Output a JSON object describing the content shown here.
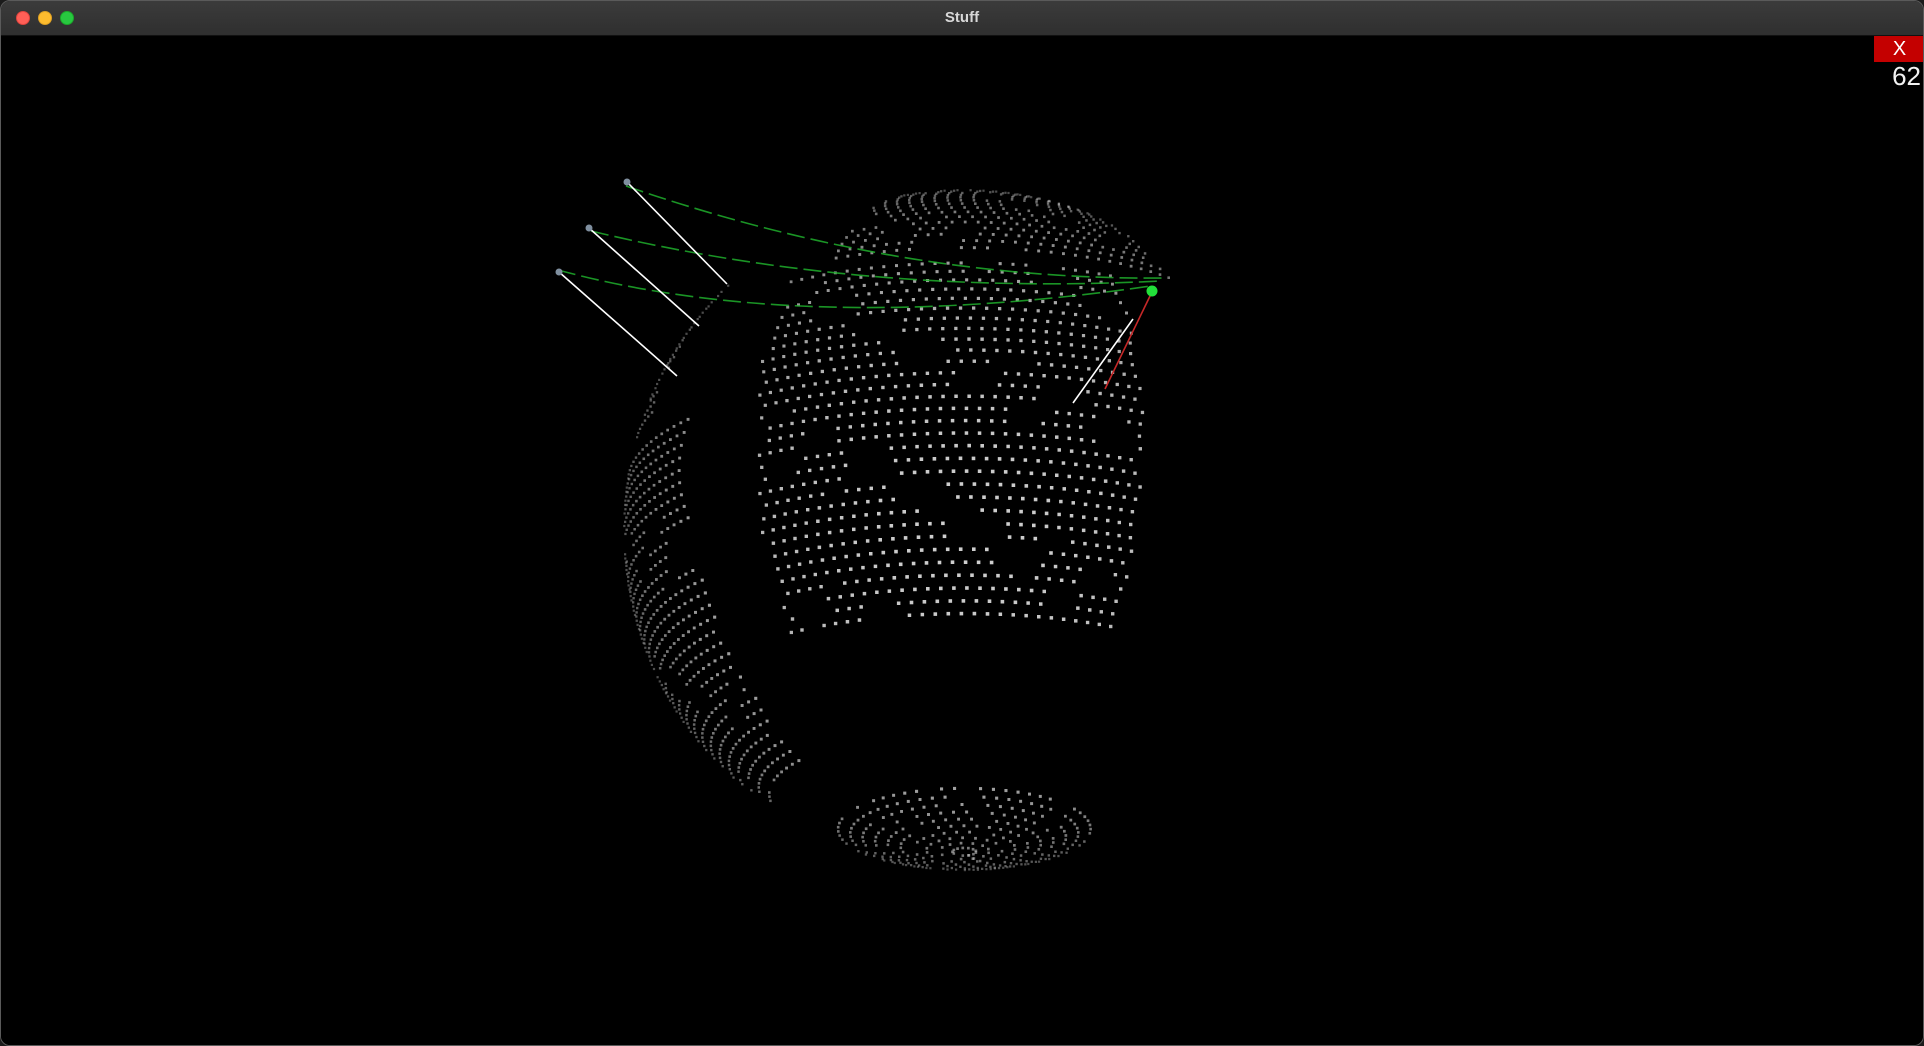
{
  "window": {
    "title": "Stuff"
  },
  "hud": {
    "close_label": "X",
    "fps": "62"
  },
  "colors": {
    "background": "#000000",
    "land_dots": "#d9d9d9",
    "orbit_trail": "#1fae2b",
    "satellite_marker": "#22e03a",
    "link_line": "#ffffff",
    "direction_line": "#c62828",
    "close_button": "#c40000"
  },
  "icons": {
    "window_close": "red-traffic-light",
    "window_minimize": "yellow-traffic-light",
    "window_maximize": "green-traffic-light"
  }
}
